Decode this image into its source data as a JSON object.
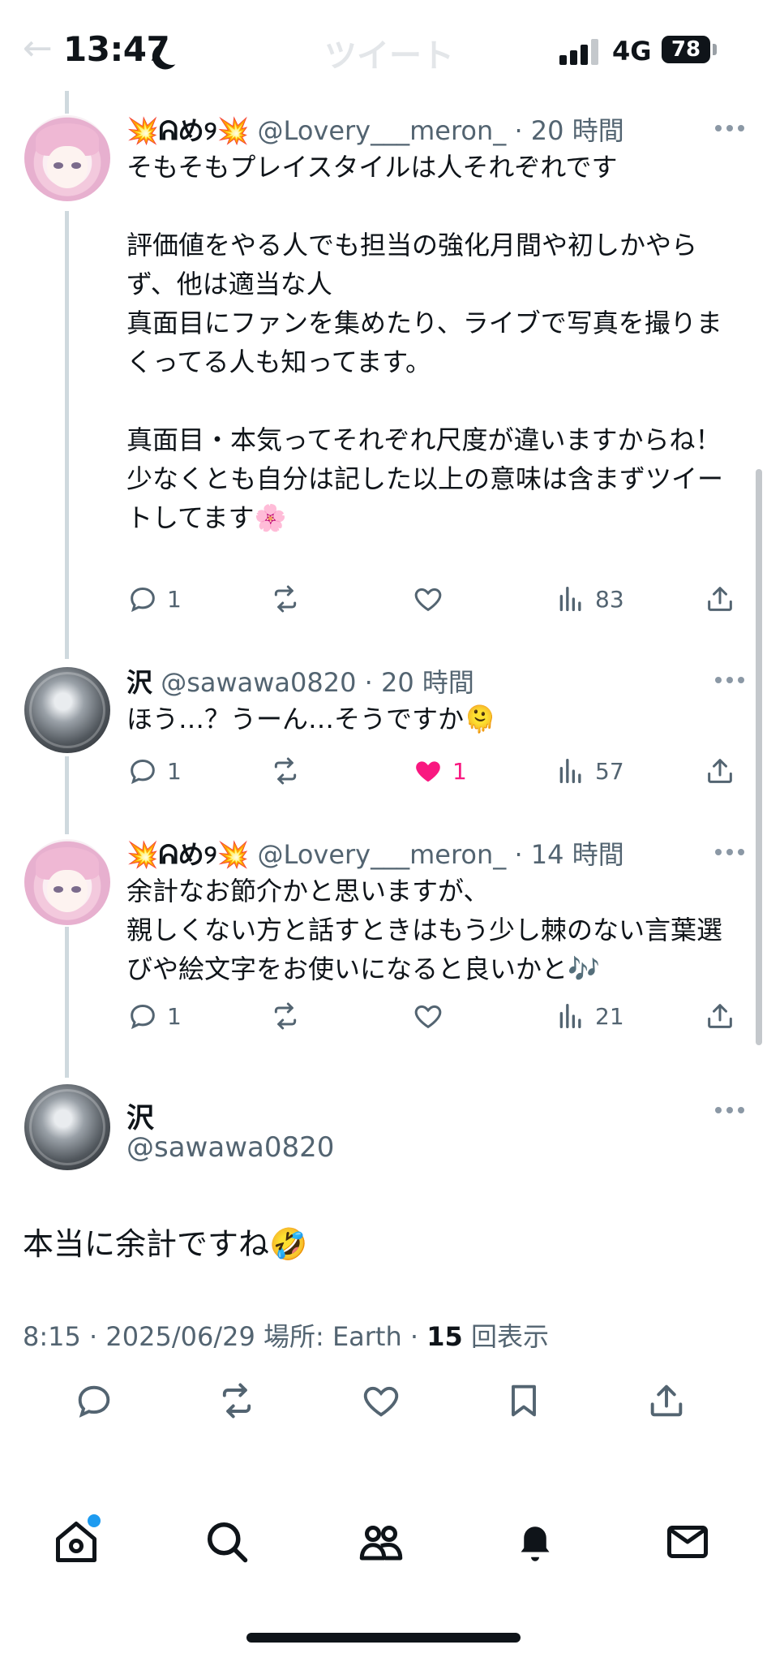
{
  "status_bar": {
    "time": "13:47",
    "network": "4G",
    "battery": "78"
  },
  "header": {
    "title": "ツイート"
  },
  "replies": [
    {
      "name": "💥ᕱめ୨💥",
      "handle": "@Lovery___meron_",
      "time": "20 時間",
      "text": "そもそもプレイスタイルは人それぞれです\n\n評価値をやる人でも担当の強化月間や初しかやらず、他は適当な人\n真面目にファンを集めたり、ライブで写真を撮りまくってる人も知ってます。\n\n真面目・本気ってそれぞれ尺度が違いますからね！\n少なくとも自分は記した以上の意味は含まずツイートしてます🌸",
      "reply_count": "1",
      "retweet_count": "",
      "like_count": "",
      "view_count": "83"
    },
    {
      "name": "沢",
      "handle": "@sawawa0820",
      "time": "20 時間",
      "text": "ほう…？うーん…そうですか🫠",
      "reply_count": "1",
      "retweet_count": "",
      "like_count": "1",
      "view_count": "57"
    },
    {
      "name": "💥ᕱめ୨💥",
      "handle": "@Lovery___meron_",
      "time": "14 時間",
      "text": "余計なお節介かと思いますが、\n親しくない方と話すときはもう少し棘のない言葉選びや絵文字をお使いになると良いかと🎶",
      "reply_count": "1",
      "retweet_count": "",
      "like_count": "",
      "view_count": "21"
    }
  ],
  "main_tweet": {
    "name": "沢",
    "handle": "@sawawa0820",
    "text": "本当に余計ですね🤣",
    "timestamp": "8:15 · 2025/06/29 場所: Earth · ",
    "views": "15",
    "views_label": "回表示"
  },
  "colors": {
    "like": "#f91880",
    "accent": "#1d9bf0",
    "secondary": "#536471"
  }
}
